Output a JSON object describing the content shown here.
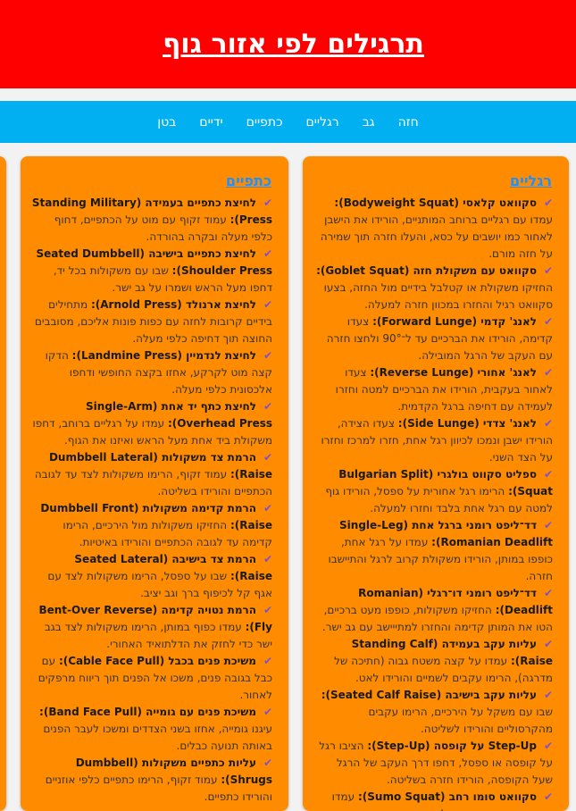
{
  "header": {
    "title": "תרגילים לפי אזור גוף"
  },
  "nav": {
    "items": [
      "חזה",
      "גב",
      "רגליים",
      "כתפיים",
      "ידיים",
      "בטן"
    ]
  },
  "cards": {
    "legs": {
      "title": "רגליים",
      "items": [
        {
          "name": "סקוואט קלאסי (Bodyweight Squat):",
          "desc": "עמדו עם רגליים ברוחב המותניים, הורידו את הישבן לאחור כמו יושבים על כסא, והעלו חזרה תוך שמירה על חזה מורם."
        },
        {
          "name": "סקוואט עם משקולת חזה (Goblet Squat):",
          "desc": "החזיקו משקולת או קטלבל בידיים מול החזה, בצעו סקוואט רגיל והחזרו במכוון חזרה למעלה."
        },
        {
          "name": "לאנג' קדמי (Forward Lunge):",
          "desc": "צעדו קדימה, הורידו את הברכיים עד ל־90° ולחצו חזרה עם העקב של הרגל המובילה."
        },
        {
          "name": "לאנג' אחורי (Reverse Lunge):",
          "desc": "צעדו לאחור בעקבית, הורידו את הברכיים למטה וחזרו לעמידה עם דחיפה ברגל הקדמית."
        },
        {
          "name": "לאנג' צדדי (Side Lunge):",
          "desc": "צעדו הצידה, הורידו ישבן ונמכו לכיוון רגל אחת, חזרו למרכז וחזרו על הצד השני."
        },
        {
          "name": "ספליט סקווט בולגרי (Bulgarian Split Squat):",
          "desc": "הרימו רגל אחורית על ספסל, הורידו גוף למטה עם רגל אחת בלבד וחזרו למעלה."
        },
        {
          "name": "דד־ליפט רומני ברגל אחת (Single-Leg Romanian Deadlift):",
          "desc": "עמדו על רגל אחת, כופפו במותן, הורידו משקולת קרוב לרגל והתיישבו חזרה."
        },
        {
          "name": "דד־ליפט רומני דו־רגלי (Romanian Deadlift):",
          "desc": "החזיקו משקולות, כופפו מעט ברכיים, הטו את המותן קדימה והחזרו למתייישב עם גב ישר."
        },
        {
          "name": "עליות עקב בעמידה (Standing Calf Raise):",
          "desc": "עמדו על קצה משטח גבוה (חתיכה של מדרגה), הרימו עקבים לשמיים והורידו לאט."
        },
        {
          "name": "עליות עקב בישיבה (Seated Calf Raise):",
          "desc": "שבו עם משקל על הירכיים, הרימו עקבים מהקרסוליים והורידו לשליטה."
        },
        {
          "name": "Step-Up על קופסה (Step-Up):",
          "desc": "הציבו רגל על קופסה או ספסל, דחפו דרך העקב של הרגל שעל הקופסה, הורידו חזרה בשליטה."
        },
        {
          "name": "סקוואט סומו רחב (Sumo Squat):",
          "desc": "עמדו במצב רחב עם כפות רגל פונות החוצה, הורידו ישבן וסקו חזרה."
        }
      ]
    },
    "shoulders": {
      "title": "כתפיים",
      "items": [
        {
          "name": "לחיצת כתפיים בעמידה (Standing Military Press):",
          "desc": "עמוד זקוף עם מוט על הכתפיים, דחוף כלפי מעלה ובקרה בהורדה."
        },
        {
          "name": "לחיצת כתפיים בישיבה (Seated Dumbbell Shoulder Press):",
          "desc": "שבו עם משקולות בכל יד, דחפו מעל הראש ושמרו על גב ישר."
        },
        {
          "name": "לחיצת ארנולד (Arnold Press):",
          "desc": "מתחילים בידיים קרובות לחזה עם כפות פונות אליכם, מסובבים החוצה תוך דחיפה כלפי מעלה."
        },
        {
          "name": "לחיצת לנדמיין (Landmine Press):",
          "desc": "הדקו קצה מוט לקרקע, אחזו בקצה החופשי ודחפו אלכסונית כלפי מעלה."
        },
        {
          "name": "לחיצת כתף יד אחת (Single-Arm Overhead Press):",
          "desc": "עמדו על רגליים ברוחב, דחפו משקולת ביד אחת מעל הראש ואיזנו את הגוף."
        },
        {
          "name": "הרמת צד משקולות (Dumbbell Lateral Raise):",
          "desc": "עמוד זקוף, הרימו משקולות לצד עד לגובה הכתפיים והורידו בשליטה."
        },
        {
          "name": "הרמת קדימה משקולות (Dumbbell Front Raise):",
          "desc": "החזיקו משקולות מול הירכיים, הרימו קדימה עד לגובה הכתפיים והורידו באיטיות."
        },
        {
          "name": "הרמת צד בישיבה (Seated Lateral Raise):",
          "desc": "שבו על ספסל, הרימו משקולות לצד עם אגף קל לכיפוף ברך וגב יציב."
        },
        {
          "name": "הרמת נטויה קדימה (Bent-Over Reverse Fly):",
          "desc": "עמדו כפוף במותן, הרימו משקולות לצד בגב ישר כדי לחזק את הדלתואיד האחורי."
        },
        {
          "name": "משיכת פנים בכבל (Cable Face Pull):",
          "desc": "עם כבל בגובה פנים, משכו אל הפנים תוך ריווח מרפקים לאחור."
        },
        {
          "name": "משיכת פנים עם גומייה (Band Face Pull):",
          "desc": "עיגנו גומייה, אחזו בשני הצדדים ומשכו לעבר הפנים באותה תנועה כבלים."
        },
        {
          "name": "עליות כתפיים משקולות (Dumbbell Shrugs):",
          "desc": "עמוד זקוף, הרימו כתפיים כלפי אוזניים והורידו כתפיים."
        }
      ]
    }
  },
  "colors": {
    "header_bg": "#ff0000",
    "nav_bg": "#00b0f0",
    "card_bg": "#ff8c00",
    "card_title": "#1e90ff",
    "check": "#7b4fd6"
  }
}
